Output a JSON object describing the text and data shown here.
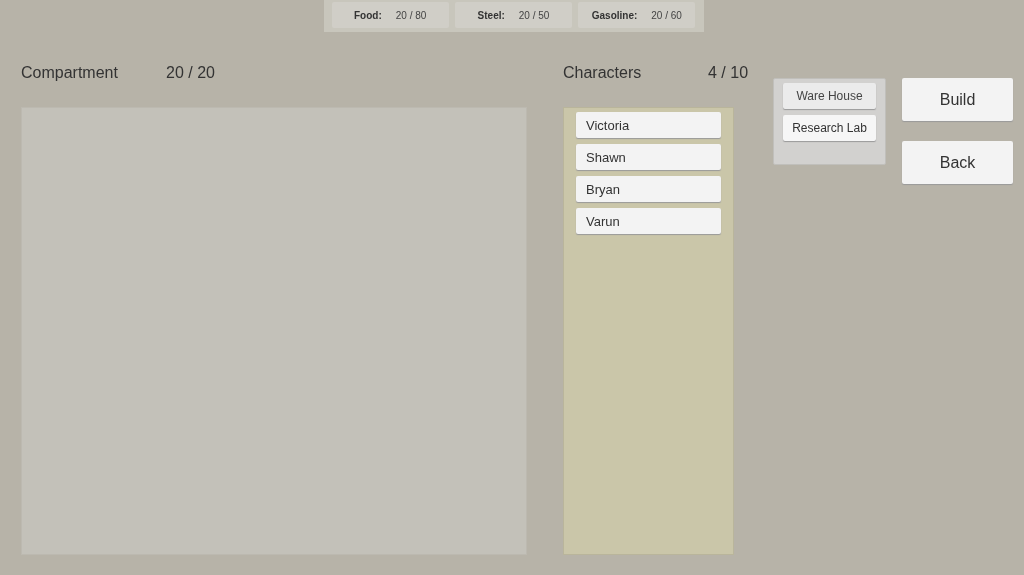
{
  "resources": [
    {
      "label": "Food:",
      "value": "20 / 80"
    },
    {
      "label": "Steel:",
      "value": "20 / 50"
    },
    {
      "label": "Gasoline:",
      "value": "20 / 60"
    }
  ],
  "compartment": {
    "title": "Compartment",
    "count": "20 / 20"
  },
  "characters": {
    "title": "Characters",
    "count": "4 / 10",
    "items": [
      {
        "name": "Victoria"
      },
      {
        "name": "Shawn"
      },
      {
        "name": "Bryan"
      },
      {
        "name": "Varun"
      }
    ]
  },
  "buildings": [
    {
      "label": "Ware House",
      "selected": true
    },
    {
      "label": "Research Lab",
      "selected": false
    }
  ],
  "actions": [
    "Build",
    "Back"
  ]
}
